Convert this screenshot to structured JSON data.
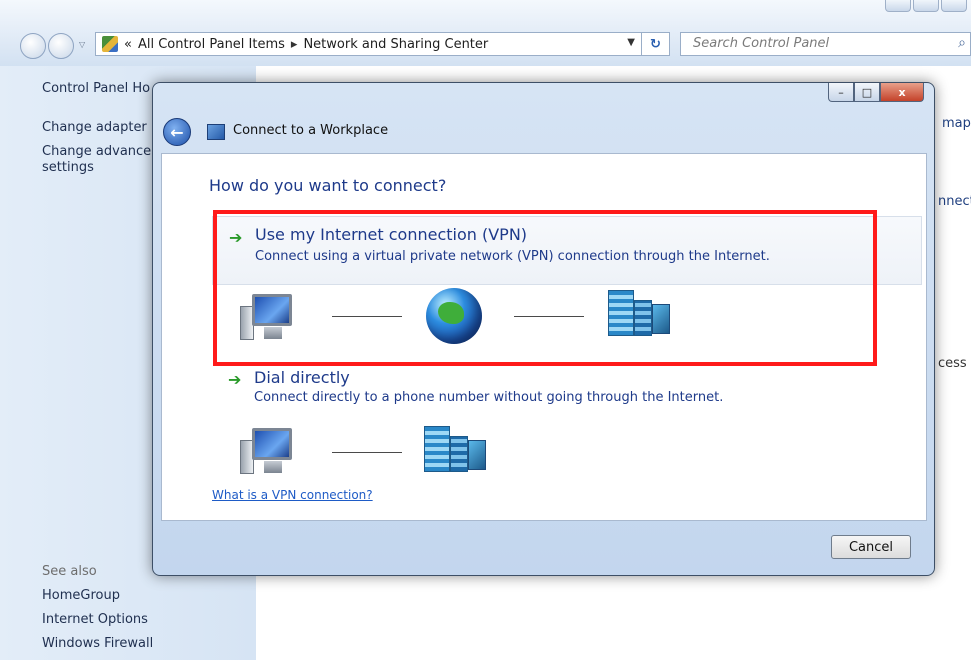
{
  "explorer": {
    "breadcrumb": {
      "root_chevron": "«",
      "item1": "All Control Panel Items",
      "separator": "▸",
      "item2": "Network and Sharing Center"
    },
    "search_placeholder": "Search Control Panel",
    "sidebar": {
      "items": [
        "Control Panel Ho",
        "Change adapter",
        "Change advance",
        "settings"
      ],
      "see_also_label": "See also",
      "see_also_items": [
        "HomeGroup",
        "Internet Options",
        "Windows Firewall"
      ]
    },
    "right_fragments": [
      "map",
      "nnect",
      "cess"
    ]
  },
  "dialog": {
    "title": "Connect to a Workplace",
    "question": "How do you want to connect?",
    "options": [
      {
        "title": "Use my Internet connection (VPN)",
        "description": "Connect using a virtual private network (VPN) connection through the Internet.",
        "icon": "green-arrow-icon"
      },
      {
        "title": "Dial directly",
        "description": "Connect directly to a phone number without going through the Internet.",
        "icon": "green-arrow-icon"
      }
    ],
    "help_link": "What is a VPN connection?",
    "cancel_label": "Cancel",
    "close_glyph": "x",
    "highlight_color": "#ff1a1a"
  }
}
